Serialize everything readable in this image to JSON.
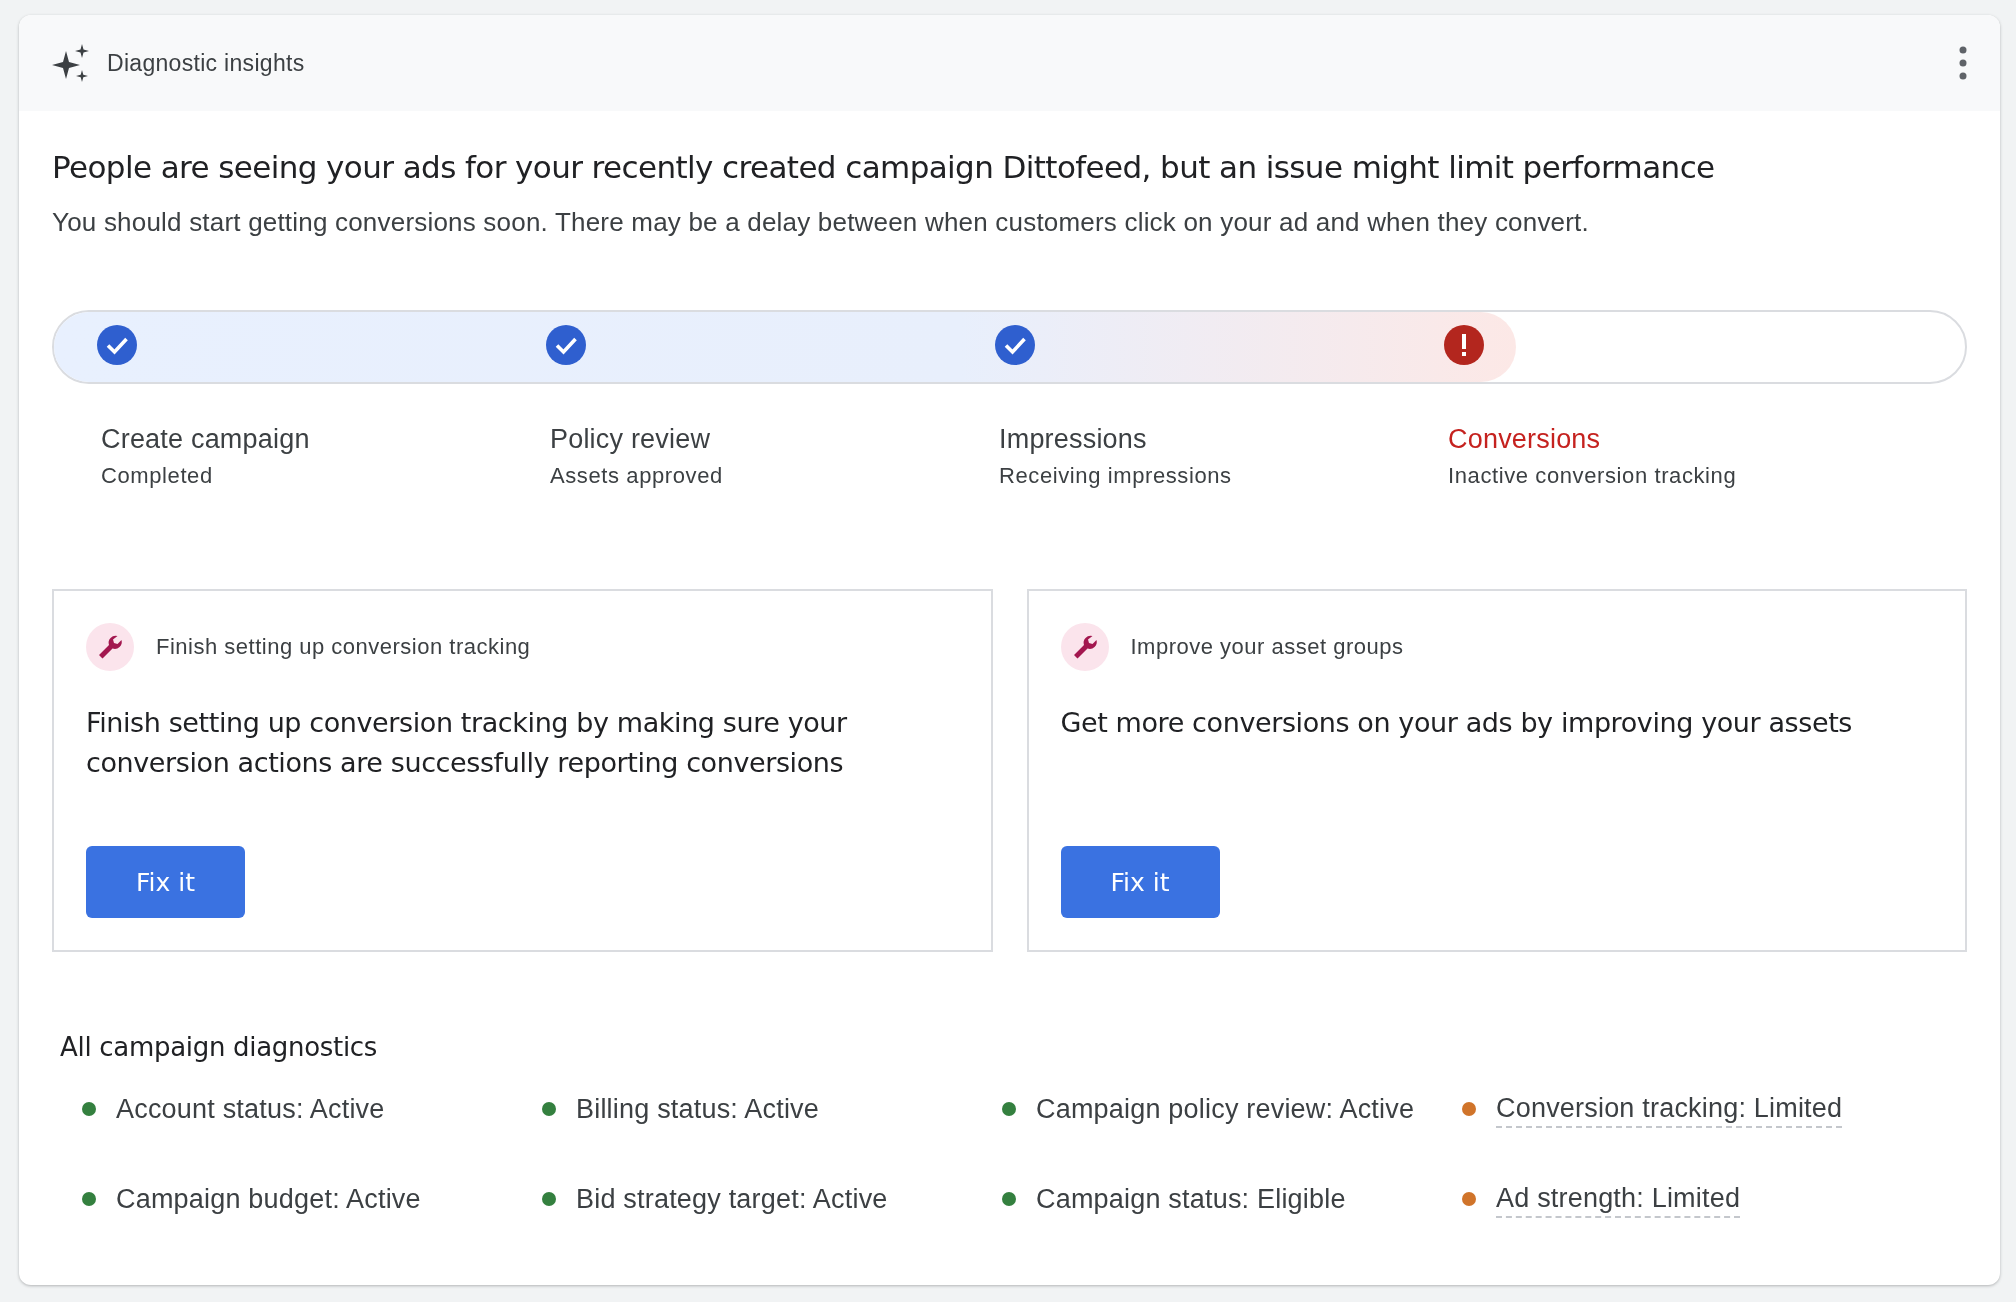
{
  "header": {
    "title": "Diagnostic insights"
  },
  "summary": {
    "headline": "People are seeing your ads for your recently created campaign Dittofeed, but an issue might limit performance",
    "text": "You should start getting conversions soon. There may be a delay between when customers click on your ad and when they convert."
  },
  "progress": {
    "level": 0.765
  },
  "steps": [
    {
      "label": "Create campaign",
      "detail": "Completed",
      "kind": "done"
    },
    {
      "label": "Policy review",
      "detail": "Assets approved",
      "kind": "done"
    },
    {
      "label": "Impressions",
      "detail": "Receiving impressions",
      "kind": "done"
    },
    {
      "label": "Conversions",
      "detail": "Inactive conversion tracking",
      "kind": "error"
    }
  ],
  "cards": [
    {
      "title": "Finish setting up conversion tracking",
      "text": "Finish setting up conversion tracking by making sure your conversion actions are successfully reporting conversions",
      "button": "Fix it"
    },
    {
      "title": "Improve your asset groups",
      "text": "Get more conversions on your ads by improving your assets",
      "button": "Fix it"
    }
  ],
  "diagnostics": {
    "title": "All campaign diagnostics",
    "items": [
      {
        "text": "Account status: Active",
        "color": "#34803f",
        "underlined": false
      },
      {
        "text": "Billing status: Active",
        "color": "#34803f",
        "underlined": false
      },
      {
        "text": "Campaign policy review: Active",
        "color": "#34803f",
        "underlined": false
      },
      {
        "text": "Conversion tracking: Limited",
        "color": "#d0742a",
        "underlined": true
      },
      {
        "text": "Campaign budget: Active",
        "color": "#34803f",
        "underlined": false
      },
      {
        "text": "Bid strategy target: Active",
        "color": "#34803f",
        "underlined": false
      },
      {
        "text": "Campaign status: Eligible",
        "color": "#34803f",
        "underlined": false
      },
      {
        "text": "Ad strength: Limited",
        "color": "#d0742a",
        "underlined": true
      }
    ]
  }
}
